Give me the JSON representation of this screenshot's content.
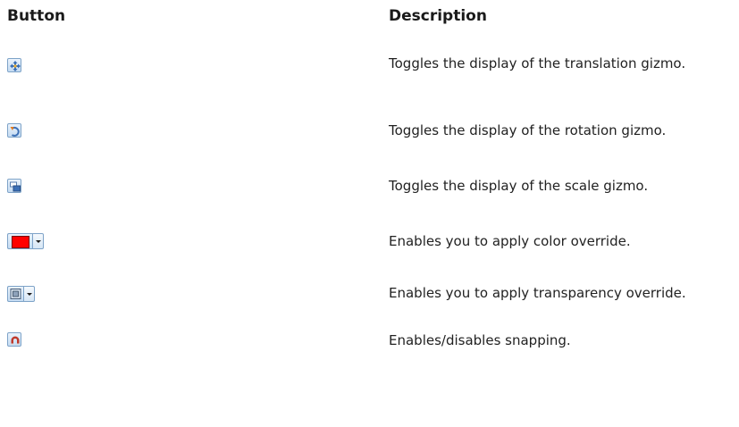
{
  "table": {
    "header_button": "Button",
    "header_description": "Description",
    "rows": [
      {
        "icon": "translation-gizmo-icon",
        "description": "Toggles the display of the translation gizmo."
      },
      {
        "icon": "rotation-gizmo-icon",
        "description": "Toggles the display of the rotation gizmo."
      },
      {
        "icon": "scale-gizmo-icon",
        "description": "Toggles the display of the scale gizmo."
      },
      {
        "icon": "color-override-icon",
        "description": "Enables you to apply color override."
      },
      {
        "icon": "transparency-override-icon",
        "description": "Enables you to apply transparency override."
      },
      {
        "icon": "snapping-magnet-icon",
        "description": "Enables/disables snapping."
      }
    ]
  },
  "colors": {
    "button_border": "#7ea3c8",
    "button_fill": "#d6e6f5",
    "color_swatch": "#ff0000",
    "magnet": "#c0392b"
  }
}
